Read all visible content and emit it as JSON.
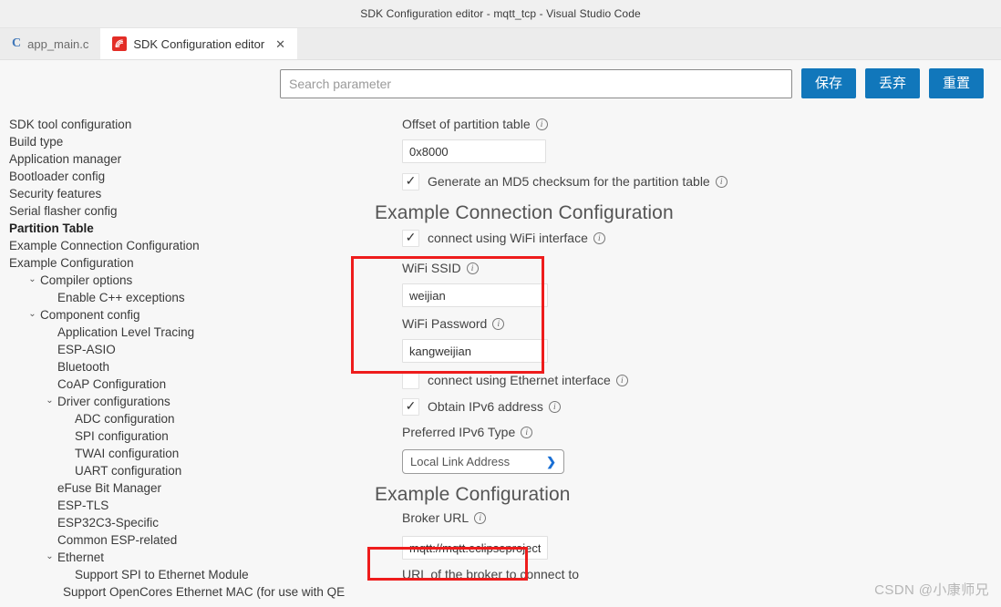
{
  "window": {
    "title": "SDK Configuration editor - mqtt_tcp - Visual Studio Code"
  },
  "tabs": [
    {
      "label": "app_main.c",
      "icon": "c-file-icon",
      "active": false
    },
    {
      "label": "SDK Configuration editor",
      "icon": "espressif-icon",
      "active": true,
      "close": "✕"
    }
  ],
  "toolbar": {
    "search_placeholder": "Search parameter",
    "search_value": "",
    "save_label": "保存",
    "discard_label": "丢弃",
    "reset_label": "重置",
    "button_color": "#1177bb"
  },
  "sidebar": {
    "items": [
      {
        "label": "SDK tool configuration",
        "indent": 0,
        "chevron": "",
        "bold": false
      },
      {
        "label": "Build type",
        "indent": 0,
        "chevron": "",
        "bold": false
      },
      {
        "label": "Application manager",
        "indent": 0,
        "chevron": "",
        "bold": false
      },
      {
        "label": "Bootloader config",
        "indent": 0,
        "chevron": "",
        "bold": false
      },
      {
        "label": "Security features",
        "indent": 0,
        "chevron": "",
        "bold": false
      },
      {
        "label": "Serial flasher config",
        "indent": 0,
        "chevron": "",
        "bold": false
      },
      {
        "label": "Partition Table",
        "indent": 0,
        "chevron": "",
        "bold": true
      },
      {
        "label": "Example Connection Configuration",
        "indent": 0,
        "chevron": "",
        "bold": false
      },
      {
        "label": "Example Configuration",
        "indent": 0,
        "chevron": "",
        "bold": false
      },
      {
        "label": "Compiler options",
        "indent": 1,
        "chevron": "⌄",
        "bold": false
      },
      {
        "label": "Enable C++ exceptions",
        "indent": 2,
        "chevron": "",
        "bold": false
      },
      {
        "label": "Component config",
        "indent": 1,
        "chevron": "⌄",
        "bold": false
      },
      {
        "label": "Application Level Tracing",
        "indent": 2,
        "chevron": "",
        "bold": false
      },
      {
        "label": "ESP-ASIO",
        "indent": 2,
        "chevron": "",
        "bold": false
      },
      {
        "label": "Bluetooth",
        "indent": 2,
        "chevron": "",
        "bold": false
      },
      {
        "label": "CoAP Configuration",
        "indent": 2,
        "chevron": "",
        "bold": false
      },
      {
        "label": "Driver configurations",
        "indent": 2,
        "chevron": "⌄",
        "bold": false
      },
      {
        "label": "ADC configuration",
        "indent": 3,
        "chevron": "",
        "bold": false
      },
      {
        "label": "SPI configuration",
        "indent": 3,
        "chevron": "",
        "bold": false
      },
      {
        "label": "TWAI configuration",
        "indent": 3,
        "chevron": "",
        "bold": false
      },
      {
        "label": "UART configuration",
        "indent": 3,
        "chevron": "",
        "bold": false
      },
      {
        "label": "eFuse Bit Manager",
        "indent": 2,
        "chevron": "",
        "bold": false
      },
      {
        "label": "ESP-TLS",
        "indent": 2,
        "chevron": "",
        "bold": false
      },
      {
        "label": "ESP32C3-Specific",
        "indent": 2,
        "chevron": "",
        "bold": false
      },
      {
        "label": "Common ESP-related",
        "indent": 2,
        "chevron": "",
        "bold": false
      },
      {
        "label": "Ethernet",
        "indent": 2,
        "chevron": "⌄",
        "bold": false
      },
      {
        "label": "Support SPI to Ethernet Module",
        "indent": 3,
        "chevron": "",
        "bold": false
      },
      {
        "label": "Support OpenCores Ethernet MAC (for use with QEMU)",
        "indent": 3,
        "chevron": "",
        "bold": false
      }
    ]
  },
  "main": {
    "partition": {
      "offset_label": "Offset of partition table",
      "offset_value": "0x8000",
      "md5_label": "Generate an MD5 checksum for the partition table",
      "md5_checked": true
    },
    "connection": {
      "heading": "Example Connection Configuration",
      "wifi_iface_label": "connect using WiFi interface",
      "wifi_iface_checked": true,
      "ssid_label": "WiFi SSID",
      "ssid_value": "weijian",
      "password_label": "WiFi Password",
      "password_value": "kangweijian",
      "eth_iface_label": "connect using Ethernet interface",
      "eth_iface_checked": false,
      "ipv6_label": "Obtain IPv6 address",
      "ipv6_checked": true,
      "ipv6_type_label": "Preferred IPv6 Type",
      "ipv6_type_value": "Local Link Address",
      "ipv6_type_chevron": "❯"
    },
    "example": {
      "heading": "Example Configuration",
      "broker_label": "Broker URL",
      "broker_value": "mqtt://mqtt.eclipseprojects",
      "broker_helper": "URL of the broker to connect to"
    },
    "annotation_color": "#ee1c1c"
  },
  "watermark": "CSDN @小康师兄"
}
